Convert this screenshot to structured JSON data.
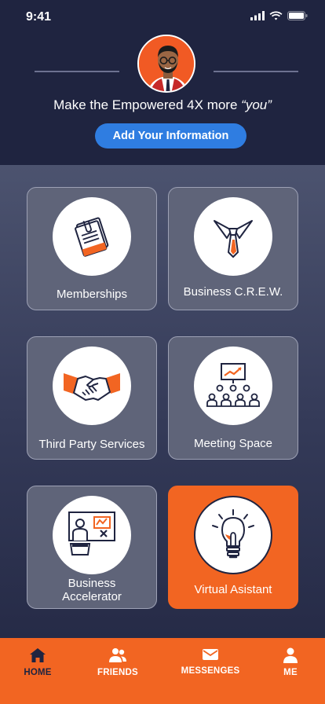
{
  "status_bar": {
    "time": "9:41"
  },
  "header": {
    "tagline_prefix": "Make the Empowered 4X more ",
    "tagline_emphasis": "“you”",
    "add_button_label": "Add Your Information"
  },
  "tiles": [
    {
      "label": "Memberships",
      "icon": "document-clip-icon"
    },
    {
      "label": "Business C.R.E.W.",
      "icon": "necktie-icon"
    },
    {
      "label": "Third Party Services",
      "icon": "handshake-icon"
    },
    {
      "label": "Meeting Space",
      "icon": "presentation-audience-icon"
    },
    {
      "label_line1": "Business",
      "label_line2": "Accelerator",
      "icon": "presenter-board-icon"
    },
    {
      "label": "Virtual Asistant",
      "icon": "lightbulb-icon"
    }
  ],
  "nav": {
    "items": [
      {
        "label": "HOME",
        "icon": "home-icon"
      },
      {
        "label": "FRIENDS",
        "icon": "friends-icon"
      },
      {
        "label": "MESSENGES",
        "icon": "envelope-icon"
      },
      {
        "label": "ME",
        "icon": "person-icon"
      }
    ]
  },
  "colors": {
    "navy": "#1f2440",
    "accent_orange": "#f26522",
    "button_blue": "#2f7de1",
    "tile_gray": "#5f6479"
  }
}
